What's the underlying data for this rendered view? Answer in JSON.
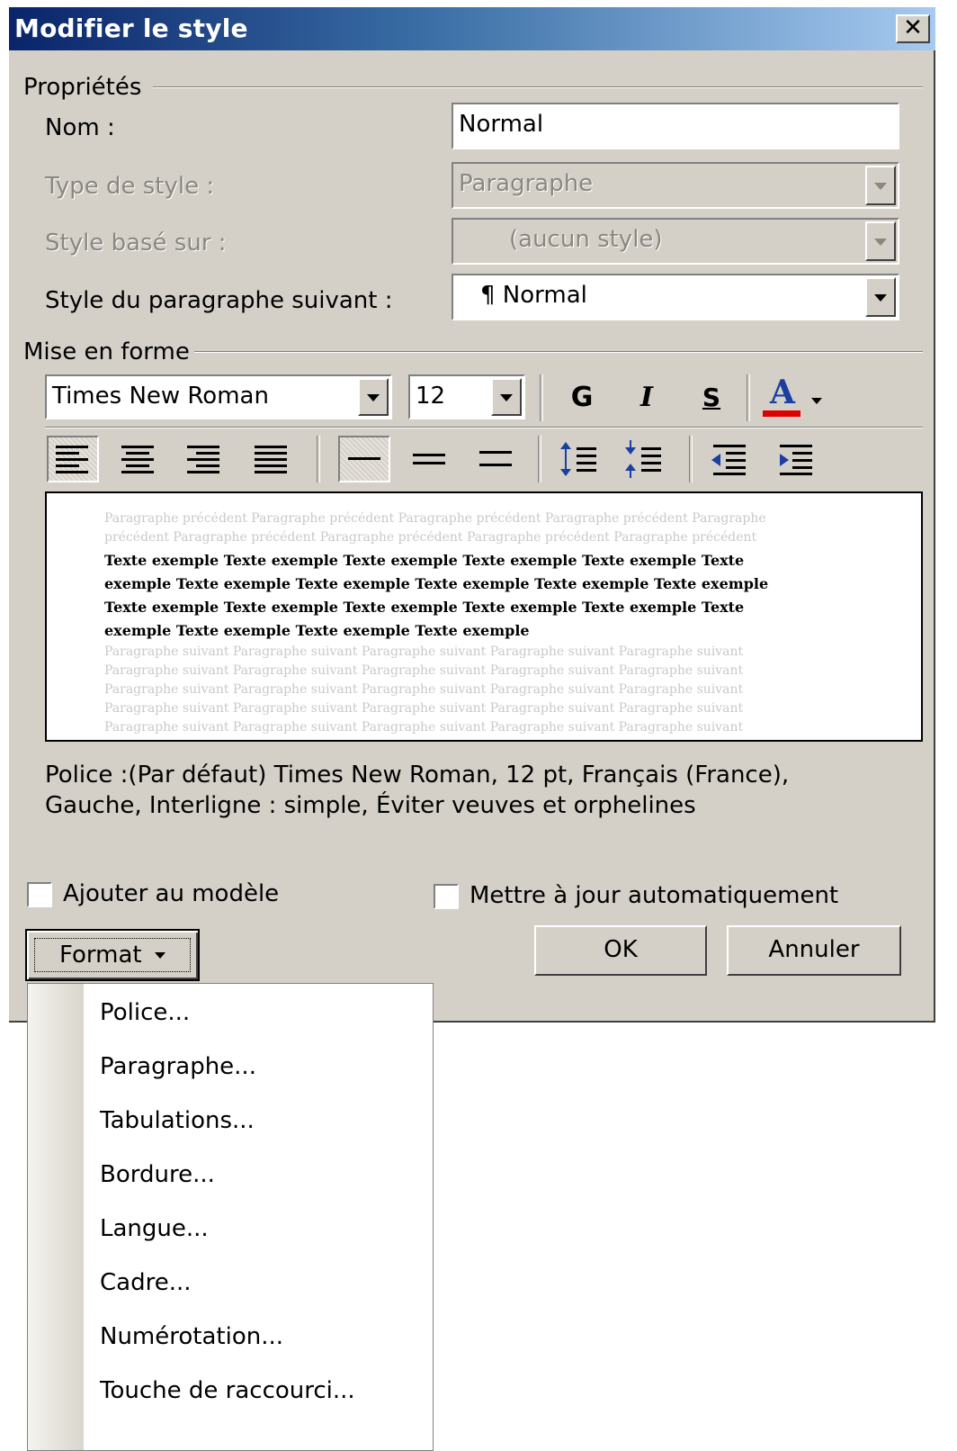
{
  "dialog": {
    "title": "Modifier le style",
    "close_label": "✕"
  },
  "properties": {
    "group_label": "Propriétés",
    "name_label": "Nom :",
    "name_value": "Normal",
    "style_type_label": "Type de style :",
    "style_type_value": "Paragraphe",
    "based_on_label": "Style basé sur :",
    "based_on_value": "(aucun style)",
    "next_style_label": "Style du paragraphe suivant :",
    "next_style_value": "¶ Normal"
  },
  "formatting": {
    "group_label": "Mise en forme",
    "font_name": "Times New Roman",
    "font_size": "12",
    "bold_label": "G",
    "italic_label": "I",
    "underline_label": "S",
    "font_color_label": "A",
    "font_color_bar": "#e00000"
  },
  "preview": {
    "previous_text": "Paragraphe précédent Paragraphe précédent Paragraphe précédent Paragraphe précédent Paragraphe précédent Paragraphe précédent Paragraphe précédent Paragraphe précédent Paragraphe précédent",
    "sample_text": "Texte exemple Texte exemple Texte exemple Texte exemple Texte exemple Texte exemple Texte exemple Texte exemple Texte exemple Texte exemple Texte exemple Texte exemple Texte exemple Texte exemple Texte exemple Texte exemple Texte exemple Texte exemple Texte exemple Texte exemple",
    "following_text": "Paragraphe suivant Paragraphe suivant Paragraphe suivant Paragraphe suivant Paragraphe suivant Paragraphe suivant Paragraphe suivant Paragraphe suivant Paragraphe suivant Paragraphe suivant Paragraphe suivant Paragraphe suivant Paragraphe suivant Paragraphe suivant Paragraphe suivant Paragraphe suivant Paragraphe suivant Paragraphe suivant Paragraphe suivant Paragraphe suivant Paragraphe suivant Paragraphe suivant Paragraphe suivant Paragraphe suivant Paragraphe suivant"
  },
  "description": {
    "line1": "Police :(Par défaut) Times New Roman, 12 pt, Français (France),",
    "line2": "Gauche, Interligne : simple, Éviter veuves et orphelines"
  },
  "options": {
    "add_to_template_label": "Ajouter au modèle",
    "auto_update_label": "Mettre à jour automatiquement"
  },
  "buttons": {
    "format_label": "Format",
    "ok_label": "OK",
    "cancel_label": "Annuler"
  },
  "format_menu": {
    "items": [
      "Police...",
      "Paragraphe...",
      "Tabulations...",
      "Bordure...",
      "Langue...",
      "Cadre...",
      "Numérotation...",
      "Touche de raccourci..."
    ]
  }
}
